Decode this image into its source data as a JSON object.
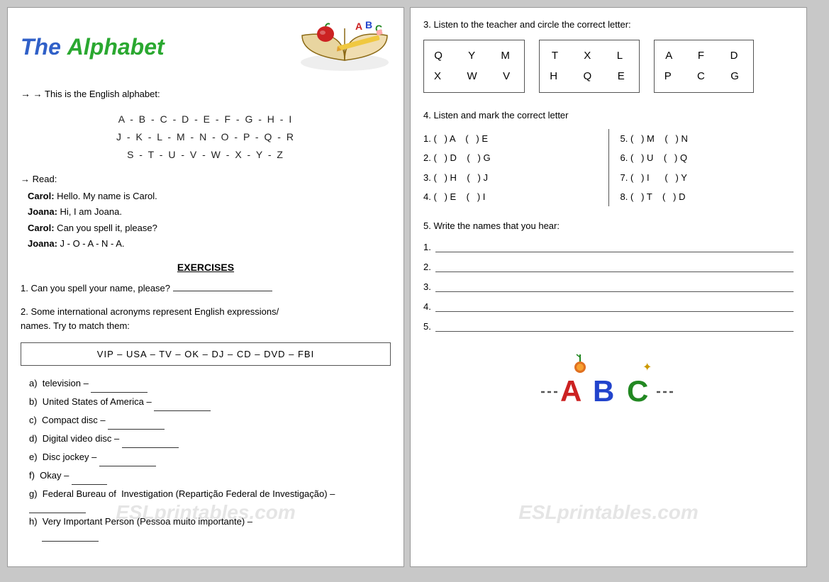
{
  "left": {
    "title": {
      "the": "The",
      "alphabet": "Alphabet"
    },
    "intro": "→ This is the English alphabet:",
    "alphabet_rows": [
      "A  -  B  -  C  -  D  -  E  -  F  -  G  -  H  -  I",
      "J  -  K  -  L  -  M  -  N  -  O  -  P  -  Q  -  R",
      "S  -  T  -  U  -  V  -  W  -  X  -  Y  -  Z"
    ],
    "read_label": "→ Read:",
    "dialogue": [
      {
        "speaker": "Carol:",
        "text": " Hello. My name is Carol."
      },
      {
        "speaker": "Joana:",
        "text": "  Hi, I am Joana."
      },
      {
        "speaker": "Carol:",
        "text": " Can you spell it, please?"
      },
      {
        "speaker": "Joana:",
        "text": "  J - O - A - N - A."
      }
    ],
    "exercises_title": "EXERCISES",
    "ex1": "1. Can you spell your name, please?",
    "ex2_line1": "2. Some international acronyms represent English expressions/",
    "ex2_line2": "names. Try to match them:",
    "acronyms": "VIP  –  USA  –  TV  –  OK  –  DJ  –  CD  –  DVD  –  FBI",
    "match_items": [
      {
        "letter": "a)",
        "text": "television –"
      },
      {
        "letter": "b)",
        "text": "United States of America –"
      },
      {
        "letter": "c)",
        "text": "Compact disc –"
      },
      {
        "letter": "d)",
        "text": "Digital video disc –"
      },
      {
        "letter": "e)",
        "text": "Disc jockey –"
      },
      {
        "letter": "f)",
        "text": "Okay –"
      },
      {
        "letter": "g)",
        "text": "Federal Bureau of  Investigation (Repartição Federal de Investigação) –"
      },
      {
        "letter": "h)",
        "text": "Very Important Person (Pessoa muito importante) –"
      }
    ]
  },
  "right": {
    "ex3_title": "3. Listen to the teacher and circle the correct letter:",
    "letter_boxes": [
      {
        "row1": "Q    Y    M",
        "row2": "X    W    V"
      },
      {
        "row1": "T    X    L",
        "row2": "H    Q    E"
      },
      {
        "row1": "A    F    D",
        "row2": "P    C    G"
      }
    ],
    "ex4_title": "4. Listen and mark the correct letter",
    "ex4_left": [
      "1. (   ) A     (   ) E",
      "2. (   ) D     (   ) G",
      "3. (   ) H     (   ) J",
      "4. (   ) E     (   ) I"
    ],
    "ex4_right": [
      "5. (   ) M     (   ) N",
      "6. (   ) U     (   ) Q",
      "7. (   ) I      (   ) Y",
      "8. (   ) T     (   ) D"
    ],
    "ex5_title": "5. Write the names that you hear:",
    "write_lines": [
      "1.",
      "2.",
      "3.",
      "4.",
      "5."
    ]
  }
}
